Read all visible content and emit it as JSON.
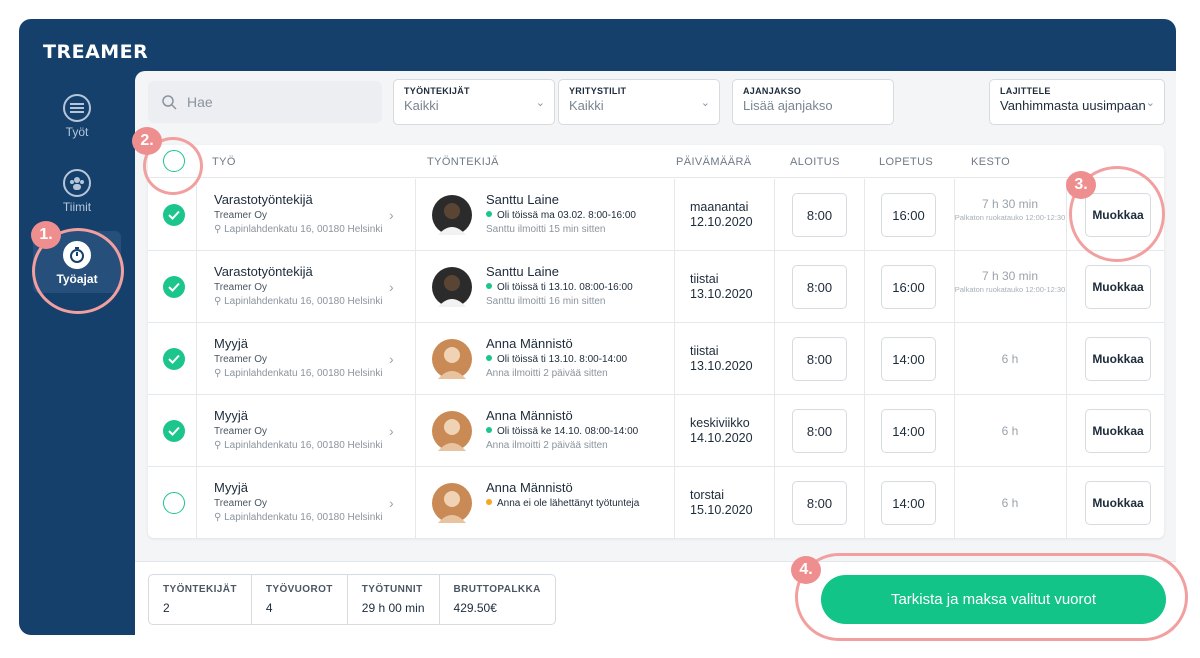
{
  "app": {
    "logo": "TREAMER"
  },
  "nav": [
    {
      "label": "Työt",
      "icon": "list-icon"
    },
    {
      "label": "Tiimit",
      "icon": "team-icon"
    },
    {
      "label": "Työajat",
      "icon": "stopwatch-icon",
      "active": true
    }
  ],
  "search": {
    "placeholder": "Hae"
  },
  "filters": [
    {
      "label": "TYÖNTEKIJÄT",
      "value": "Kaikki"
    },
    {
      "label": "YRITYSTILIT",
      "value": "Kaikki"
    },
    {
      "label": "AJANJAKSO",
      "value": "Lisää ajanjakso"
    },
    {
      "label": "LAJITTELE",
      "value": "Vanhimmasta uusimpaan"
    }
  ],
  "table": {
    "headers": {
      "job": "TYÖ",
      "employee": "TYÖNTEKIJÄ",
      "date": "PÄIVÄMÄÄRÄ",
      "start": "ALOITUS",
      "end": "LOPETUS",
      "duration": "KESTO"
    },
    "rows": [
      {
        "checked": true,
        "job_title": "Varastotyöntekijä",
        "company": "Treamer Oy",
        "address": "Lapinlahdenkatu 16, 00180 Helsinki",
        "employee": "Santtu Laine",
        "status": "Oli töissä ma 03.02. 8:00-16:00",
        "status_color": "#1cc58c",
        "reported": "Santtu ilmoitti 15 min sitten",
        "day": "maanantai",
        "date": "12.10.2020",
        "start": "8:00",
        "end": "16:00",
        "duration": "7 h 30 min",
        "duration_note": "Palkaton ruokatauko 12:00-12:30",
        "edit": "Muokkaa"
      },
      {
        "checked": true,
        "job_title": "Varastotyöntekijä",
        "company": "Treamer Oy",
        "address": "Lapinlahdenkatu 16, 00180 Helsinki",
        "employee": "Santtu Laine",
        "status": "Oli töissä ti 13.10. 08:00-16:00",
        "status_color": "#1cc58c",
        "reported": "Santtu ilmoitti 16 min sitten",
        "day": "tiistai",
        "date": "13.10.2020",
        "start": "8:00",
        "end": "16:00",
        "duration": "7 h 30 min",
        "duration_note": "Palkaton ruokatauko 12:00-12:30",
        "edit": "Muokkaa"
      },
      {
        "checked": true,
        "job_title": "Myyjä",
        "company": "Treamer Oy",
        "address": "Lapinlahdenkatu 16, 00180 Helsinki",
        "employee": "Anna Männistö",
        "status": "Oli töissä ti 13.10. 8:00-14:00",
        "status_color": "#1cc58c",
        "reported": "Anna ilmoitti 2 päivää sitten",
        "day": "tiistai",
        "date": "13.10.2020",
        "start": "8:00",
        "end": "14:00",
        "duration": "6 h",
        "duration_note": "",
        "edit": "Muokkaa"
      },
      {
        "checked": true,
        "job_title": "Myyjä",
        "company": "Treamer Oy",
        "address": "Lapinlahdenkatu 16, 00180 Helsinki",
        "employee": "Anna Männistö",
        "status": "Oli töissä ke 14.10. 08:00-14:00",
        "status_color": "#1cc58c",
        "reported": "Anna ilmoitti 2 päivää sitten",
        "day": "keskiviikko",
        "date": "14.10.2020",
        "start": "8:00",
        "end": "14:00",
        "duration": "6 h",
        "duration_note": "",
        "edit": "Muokkaa"
      },
      {
        "checked": false,
        "job_title": "Myyjä",
        "company": "Treamer Oy",
        "address": "Lapinlahdenkatu 16, 00180 Helsinki",
        "employee": "Anna Männistö",
        "status": "Anna ei ole lähettänyt työtunteja",
        "status_color": "#f5a623",
        "reported": "",
        "day": "torstai",
        "date": "15.10.2020",
        "start": "8:00",
        "end": "14:00",
        "duration": "6 h",
        "duration_note": "",
        "edit": "Muokkaa"
      }
    ]
  },
  "summary": [
    {
      "label": "TYÖNTEKIJÄT",
      "value": "2"
    },
    {
      "label": "TYÖVUOROT",
      "value": "4"
    },
    {
      "label": "TYÖTUNNIT",
      "value": "29 h 00 min"
    },
    {
      "label": "BRUTTOPALKKA",
      "value": "429.50€"
    }
  ],
  "pay_button": "Tarkista ja maksa valitut vuorot",
  "annotations": [
    "1.",
    "2.",
    "3.",
    "4."
  ],
  "colors": {
    "sidebar": "#15406b",
    "accent": "#1cc58c",
    "annotation": "#ef8e8e"
  }
}
